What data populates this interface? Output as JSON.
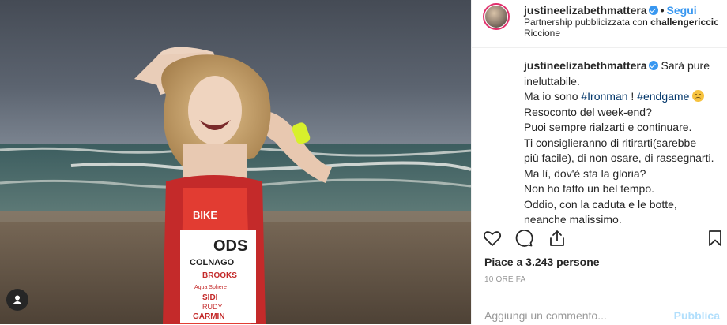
{
  "post": {
    "username": "justineelizabethmattera",
    "follow_label": "Segui",
    "partnership_text": "Partnership pubblicizzata con ",
    "partner_name": "challengericcio...",
    "location": "Riccione",
    "caption_lines": [
      "Sarà pure",
      "ineluttabile.",
      "Ma io sono ",
      "#Ironman",
      " ! ",
      "#endgame",
      "Resoconto del week-end?",
      "Puoi sempre rialzarti e continuare.",
      "Ti consiglieranno di ritirarti(sarebbe",
      "più facile), di non osare, di rassegnarti.",
      "Ma lì, dov'è sta la gloria?",
      "Non ho fatto un bel tempo.",
      "Oddio, con la caduta e le botte,",
      "neanche malissimo."
    ],
    "likes_text": "Piace a 3.243 persone",
    "time_text": "10 ORE FA",
    "comment_placeholder": "Aggiungi un commento...",
    "publish_label": "Pubblica"
  },
  "jersey_text": {
    "bike": "BIKE",
    "brand1": "ODS",
    "brand2": "COLNAGO",
    "brand3": "BROOKS",
    "brand4": "Aqua Sphere",
    "brand5": "SIDI",
    "brand6": "RUDY",
    "brand7": "GARMIN"
  },
  "icons": {
    "like": "heart-icon",
    "comment": "comment-icon",
    "share": "share-icon",
    "save": "bookmark-icon",
    "tag": "person-tag-icon"
  }
}
